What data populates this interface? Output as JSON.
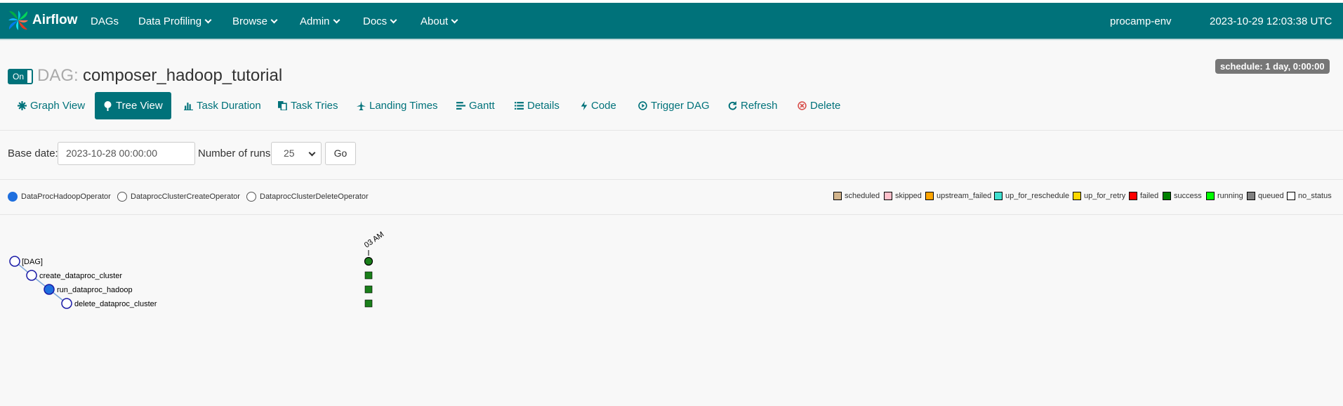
{
  "navbar": {
    "brand": "Airflow",
    "items": [
      {
        "label": "DAGs",
        "dropdown": false
      },
      {
        "label": "Data Profiling",
        "dropdown": true
      },
      {
        "label": "Browse",
        "dropdown": true
      },
      {
        "label": "Admin",
        "dropdown": true
      },
      {
        "label": "Docs",
        "dropdown": true
      },
      {
        "label": "About",
        "dropdown": true
      }
    ],
    "env": "procamp-env",
    "datetime": "2023-10-29 12:03:38 UTC"
  },
  "dag": {
    "toggle_label": "On",
    "prefix": "DAG:",
    "name": "composer_hadoop_tutorial",
    "schedule": "schedule: 1 day, 0:00:00"
  },
  "tabs": [
    {
      "label": "Graph View",
      "icon": "asterisk-icon"
    },
    {
      "label": "Tree View",
      "icon": "tree-icon",
      "active": true
    },
    {
      "label": "Task Duration",
      "icon": "bar-chart-icon"
    },
    {
      "label": "Task Tries",
      "icon": "copy-icon"
    },
    {
      "label": "Landing Times",
      "icon": "plane-icon"
    },
    {
      "label": "Gantt",
      "icon": "align-left-icon"
    },
    {
      "label": "Details",
      "icon": "list-icon"
    },
    {
      "label": "Code",
      "icon": "flash-icon"
    },
    {
      "label": "Trigger DAG",
      "icon": "play-circle-icon"
    },
    {
      "label": "Refresh",
      "icon": "refresh-icon"
    },
    {
      "label": "Delete",
      "icon": "remove-circle-icon"
    }
  ],
  "form": {
    "base_date_label": "Base date:",
    "base_date_value": "2023-10-28 00:00:00",
    "num_runs_label": "Number of runs:",
    "num_runs_value": "25",
    "go_label": "Go"
  },
  "operators": [
    {
      "label": "DataProcHadoopOperator",
      "color": "#1f6fde"
    },
    {
      "label": "DataprocClusterCreateOperator",
      "color": "#ffffff"
    },
    {
      "label": "DataprocClusterDeleteOperator",
      "color": "#ffffff"
    }
  ],
  "states": [
    {
      "label": "scheduled",
      "color": "#d2b48c"
    },
    {
      "label": "skipped",
      "color": "#ffc0cb"
    },
    {
      "label": "upstream_failed",
      "color": "#ffa500"
    },
    {
      "label": "up_for_reschedule",
      "color": "#40e0d0"
    },
    {
      "label": "up_for_retry",
      "color": "#ffd700"
    },
    {
      "label": "failed",
      "color": "#ff0000"
    },
    {
      "label": "success",
      "color": "#008000"
    },
    {
      "label": "running",
      "color": "#00ff00"
    },
    {
      "label": "queued",
      "color": "#808080"
    },
    {
      "label": "no_status",
      "color": "#ffffff"
    }
  ],
  "tree": {
    "run_label": "03 AM",
    "nodes": [
      {
        "label": "[DAG]",
        "fill": "#ffffff"
      },
      {
        "label": "create_dataproc_cluster",
        "fill": "#ffffff"
      },
      {
        "label": "run_dataproc_hadoop",
        "fill": "#1f6fde"
      },
      {
        "label": "delete_dataproc_cluster",
        "fill": "#ffffff"
      }
    ],
    "instance_state": "success",
    "instance_color": "#1a7f1a"
  }
}
